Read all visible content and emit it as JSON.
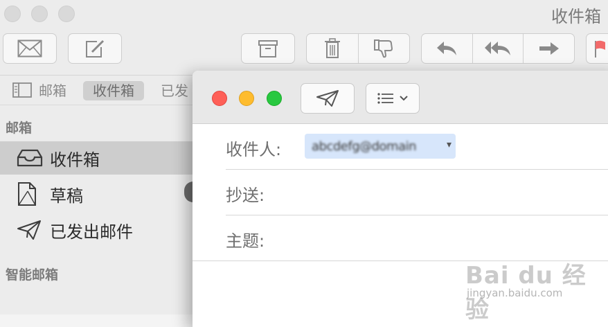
{
  "window": {
    "title": "收件箱"
  },
  "favorites": {
    "mailboxes": "邮箱",
    "inbox": "收件箱",
    "sent": "已发"
  },
  "sidebar": {
    "section_mailboxes": "邮箱",
    "items": [
      {
        "label": "收件箱",
        "icon": "inbox-tray-icon",
        "selected": true
      },
      {
        "label": "草稿",
        "icon": "draft-document-icon",
        "selected": false
      },
      {
        "label": "已发出邮件",
        "icon": "paper-plane-icon",
        "selected": false
      }
    ],
    "section_smart": "智能邮箱"
  },
  "compose": {
    "to_label": "收件人:",
    "to_value": "abcdefg@domain",
    "cc_label": "抄送:",
    "subject_label": "主题:"
  },
  "watermark": {
    "main": "Bai du 经验",
    "sub": "jingyan.baidu.com"
  },
  "colors": {
    "selection": "#cdcdcd",
    "recipient_chip": "#d7e6fb",
    "flag": "#f26a6a"
  }
}
